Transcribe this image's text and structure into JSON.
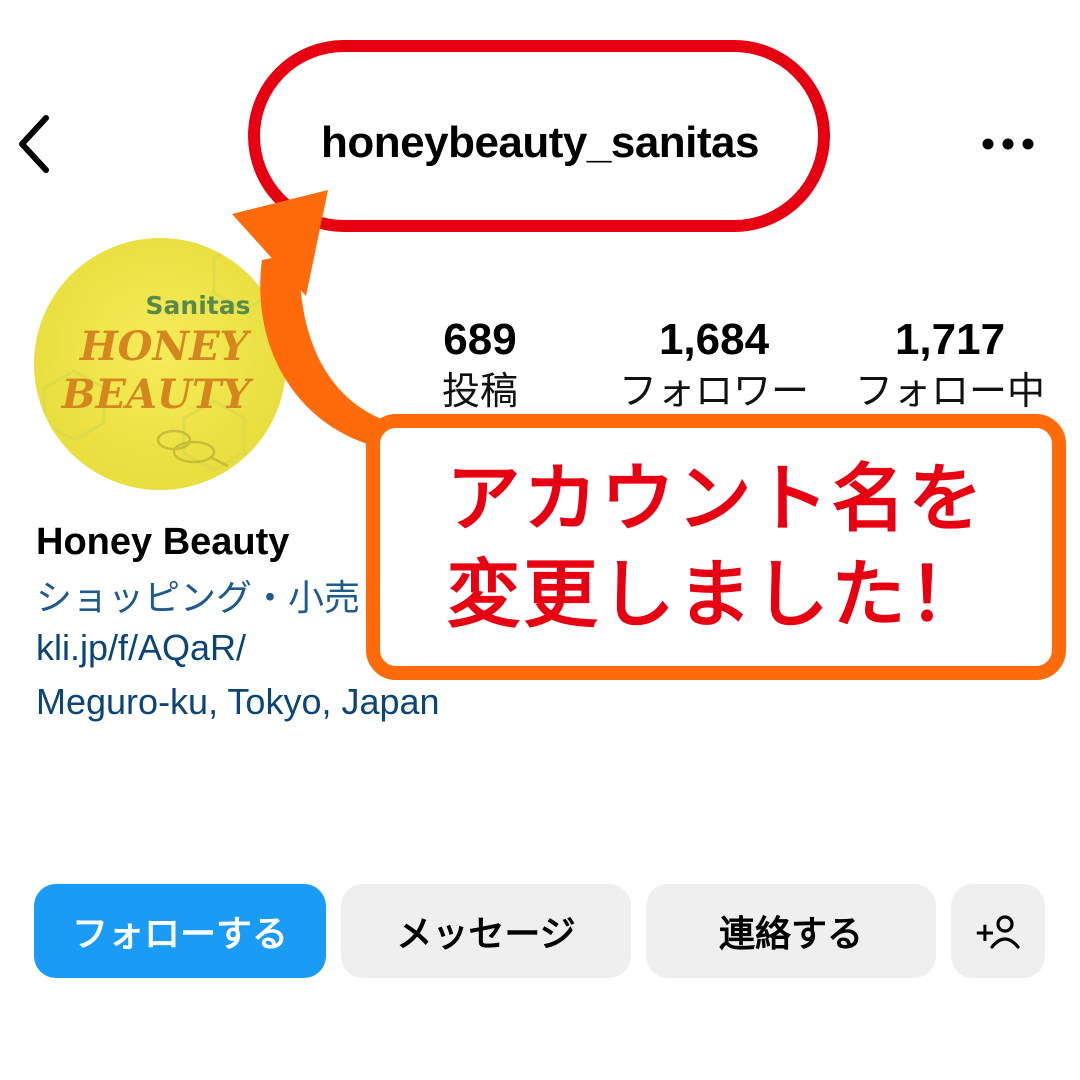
{
  "header": {
    "username": "honeybeauty_sanitas",
    "back_icon": "chevron-left-icon",
    "more_icon": "more-horizontal-icon"
  },
  "avatar": {
    "brand": "Sanitas",
    "line1": "HONEY",
    "line2": "BEAUTY"
  },
  "stats": [
    {
      "value": "689",
      "label": "投稿"
    },
    {
      "value": "1,684",
      "label": "フォロワー"
    },
    {
      "value": "1,717",
      "label": "フォロー中"
    }
  ],
  "profile": {
    "display_name": "Honey Beauty",
    "category": "ショッピング・小売",
    "link": "kli.jp/f/AQaR/",
    "location": "Meguro-ku, Tokyo, Japan"
  },
  "buttons": {
    "follow": "フォローする",
    "message": "メッセージ",
    "contact": "連絡する",
    "add_person": "+"
  },
  "callout": {
    "line1": "アカウント名を",
    "line2": "変更しました！"
  },
  "colors": {
    "follow_button": "#1a9bf5",
    "annotation_ring": "#e60012",
    "annotation_orange": "#ff6a0a",
    "callout_text": "#e60012",
    "link_text": "#0b4477"
  }
}
